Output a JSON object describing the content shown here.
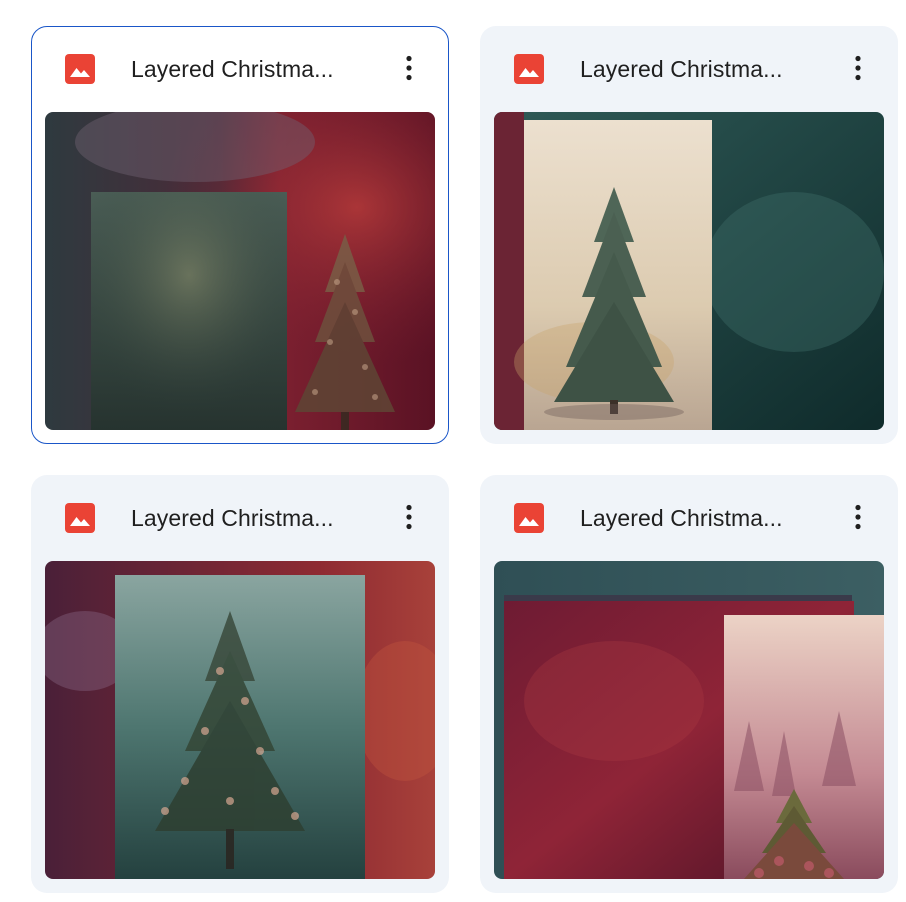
{
  "files": [
    {
      "name": "Layered Christma...",
      "icon": "image-file-icon",
      "selected": true,
      "thumbnail": "green-panel-with-tree-on-red-backdrop"
    },
    {
      "name": "Layered Christma...",
      "icon": "image-file-icon",
      "selected": false,
      "thumbnail": "cream-panel-with-tree-on-teal-backdrop"
    },
    {
      "name": "Layered Christma...",
      "icon": "image-file-icon",
      "selected": false,
      "thumbnail": "teal-panel-with-tree-on-purple-red-backdrop"
    },
    {
      "name": "Layered Christma...",
      "icon": "image-file-icon",
      "selected": false,
      "thumbnail": "layered-red-and-pink-panels-with-tree"
    }
  ],
  "colors": {
    "icon_red": "#ea4335",
    "card_bg": "#f0f4f9",
    "selected_border": "#1a56c8",
    "text": "#1f1f1f"
  }
}
